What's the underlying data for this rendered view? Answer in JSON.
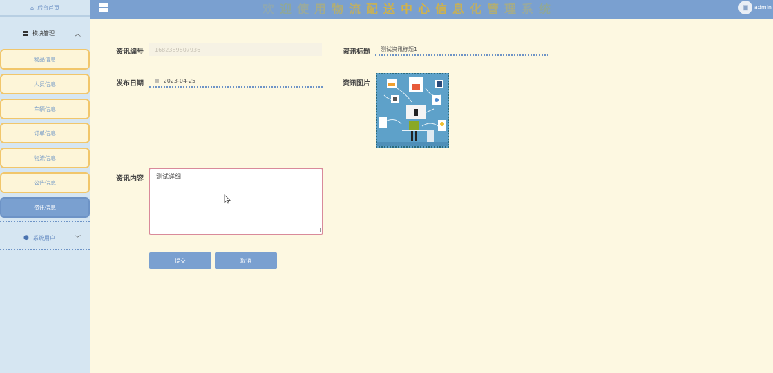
{
  "header": {
    "title_chars": [
      "欢",
      "迎",
      "使",
      "用",
      "物",
      "流",
      "配",
      "送",
      "中",
      "心",
      "信",
      "息",
      "化",
      "管",
      "理",
      "系",
      "统"
    ],
    "title_colors": [
      "#8da7b4",
      "#8fa79a",
      "#98a9a0",
      "#a3ab8c",
      "#b0ad76",
      "#bcae68",
      "#c5b05a",
      "#ccb14f",
      "#d1b24a",
      "#d1b24a",
      "#ccb14f",
      "#c5b05a",
      "#bcae68",
      "#b0ad76",
      "#a3ab8c",
      "#98a9a0",
      "#8fa79a"
    ],
    "user_name": "admin"
  },
  "sidebar": {
    "home_label": "后台首页",
    "module_group_label": "模块管理",
    "items": [
      {
        "label": "物品信息"
      },
      {
        "label": "人员信息"
      },
      {
        "label": "车辆信息"
      },
      {
        "label": "订单信息"
      },
      {
        "label": "物流信息"
      },
      {
        "label": "公告信息"
      },
      {
        "label": "资讯信息"
      }
    ],
    "users_group_label": "系统用户"
  },
  "form": {
    "id_label": "资讯编号",
    "id_value": "1682389807936",
    "title_label": "资讯标题",
    "title_value": "测试资讯标题1",
    "date_label": "发布日期",
    "date_value": "2023-04-25",
    "image_label": "资讯图片",
    "content_label": "资讯内容",
    "content_value": "测试详细",
    "submit_label": "提交",
    "cancel_label": "取消"
  },
  "colors": {
    "header_bg": "#7aa0d0",
    "sidebar_bg": "#d6e6f2",
    "page_bg": "#fdf8e1",
    "menu_border": "#f1c66b",
    "active_menu": "#7aa0d0"
  }
}
